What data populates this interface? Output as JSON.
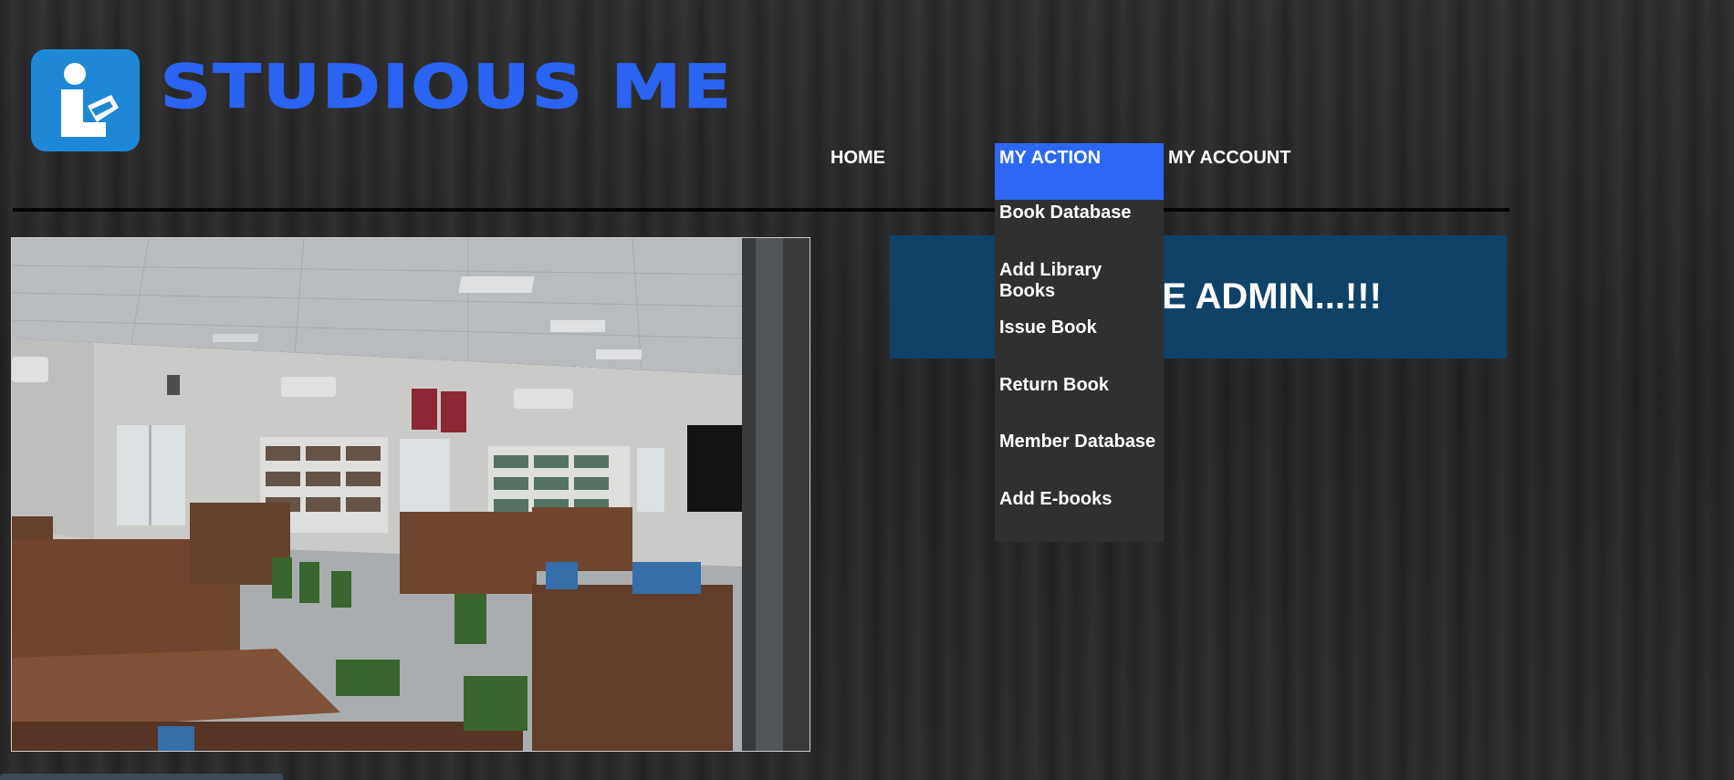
{
  "brand": {
    "name": "STUDIOUS ME",
    "logo_icon": "reading-person-icon",
    "color": "#2b63f2",
    "logo_bg": "#1e88d6"
  },
  "nav": {
    "home": "HOME",
    "my_action": "MY ACTION",
    "my_account": "MY ACCOUNT",
    "active_color": "#2c68f5"
  },
  "dropdown": {
    "items": [
      "Book Database",
      "Add Library Books",
      "Issue Book",
      "Return Book",
      "Member Database",
      "Add E-books"
    ]
  },
  "welcome": {
    "visible_text": "IE ADMIN...!!!",
    "bg_color": "#0f4268"
  },
  "photo": {
    "subject": "library-reading-room-photo"
  }
}
